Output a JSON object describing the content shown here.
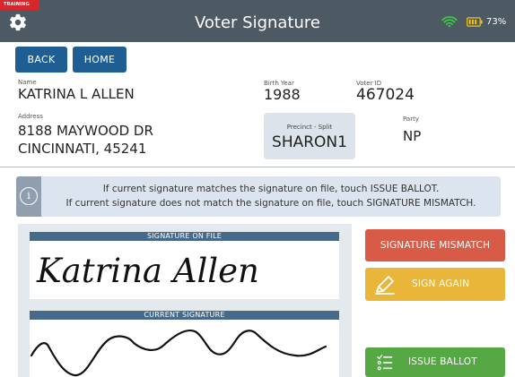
{
  "header": {
    "training_badge": "TRAINING",
    "title": "Voter Signature",
    "battery_percent": "73%"
  },
  "nav": {
    "back_label": "BACK",
    "home_label": "HOME"
  },
  "voter": {
    "name_label": "Name",
    "name": "KATRINA L ALLEN",
    "address_label": "Address",
    "address_line1": "8188 MAYWOOD DR",
    "address_line2": "CINCINNATI, 45241",
    "birth_year_label": "Birth Year",
    "birth_year": "1988",
    "voter_id_label": "Voter ID",
    "voter_id": "467024",
    "precinct_label": "Precinct - Split",
    "precinct": "SHARON1",
    "party_label": "Party",
    "party": "NP"
  },
  "info": {
    "line1": "If current signature matches the signature on file, touch ISSUE BALLOT.",
    "line2": "If current signature does not match the signature on file, touch SIGNATURE MISMATCH."
  },
  "signatures": {
    "on_file_header": "SIGNATURE ON FILE",
    "on_file_text": "Katrina Allen",
    "current_header": "CURRENT SIGNATURE"
  },
  "actions": {
    "mismatch_label": "SIGNATURE MISMATCH",
    "sign_again_label": "SIGN AGAIN",
    "issue_label": "ISSUE BALLOT"
  },
  "colors": {
    "topbar": "#4d5963",
    "nav_button": "#1e5e92",
    "mismatch": "#d75b47",
    "sign_again": "#e9b63a",
    "issue": "#56a844",
    "training": "#d9262c",
    "wifi": "#3ecb45",
    "battery": "#f0c419"
  }
}
